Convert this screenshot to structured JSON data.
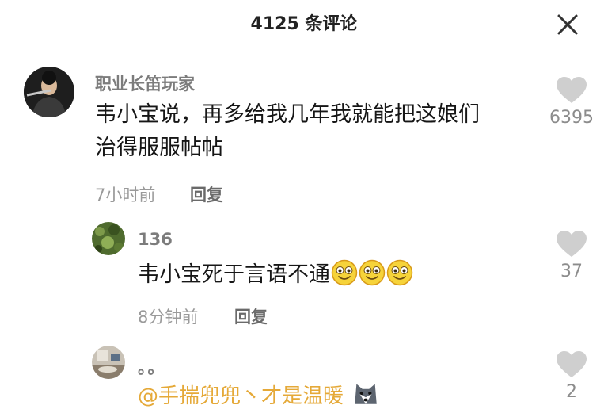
{
  "header": {
    "title": "4125 条评论",
    "close_icon": "close-icon"
  },
  "comments": [
    {
      "username": "职业长笛玩家",
      "text": "韦小宝说，再多给我几年我就能把这娘们治得服服帖帖",
      "line1": "韦小宝说，再多给我几年我就能把这娘们",
      "line2": "治得服服帖帖",
      "time": "7小时前",
      "reply_label": "回复",
      "likes": "6395",
      "avatar_icon": "flute-player-avatar"
    },
    {
      "username": "136",
      "text": "韦小宝死于言语不通",
      "emojis": [
        "grin-emoji",
        "grin-emoji",
        "grin-emoji"
      ],
      "time": "8分钟前",
      "reply_label": "回复",
      "likes": "37",
      "avatar_icon": "green-leaf-avatar"
    },
    {
      "username": "。。",
      "mention": "@手揣兜兜丶才是温暖",
      "emoji": "husky-emoji",
      "likes": "2",
      "avatar_icon": "room-photo-avatar"
    }
  ],
  "colors": {
    "mention": "#e5a938",
    "meta": "#9a9a9a",
    "like_icon": "#cfcfcf"
  }
}
